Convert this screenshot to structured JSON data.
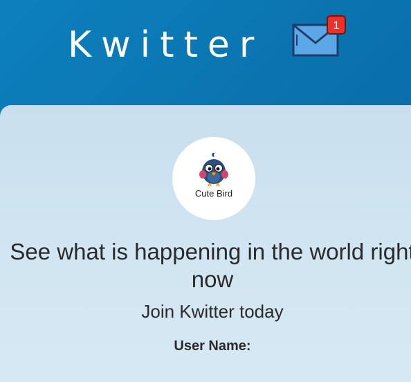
{
  "header": {
    "title": "Kwitter",
    "notification_count": "1",
    "mail_icon": "envelope-icon"
  },
  "logo": {
    "caption": "Cute Bird",
    "icon": "bird-icon"
  },
  "main": {
    "headline": "See what is happening in the world right now",
    "subline": "Join Kwitter today",
    "username_label": "User Name:"
  },
  "colors": {
    "header_bg": "#0b77b4",
    "card_bg": "#d2e6f2",
    "badge": "#e8322b"
  }
}
